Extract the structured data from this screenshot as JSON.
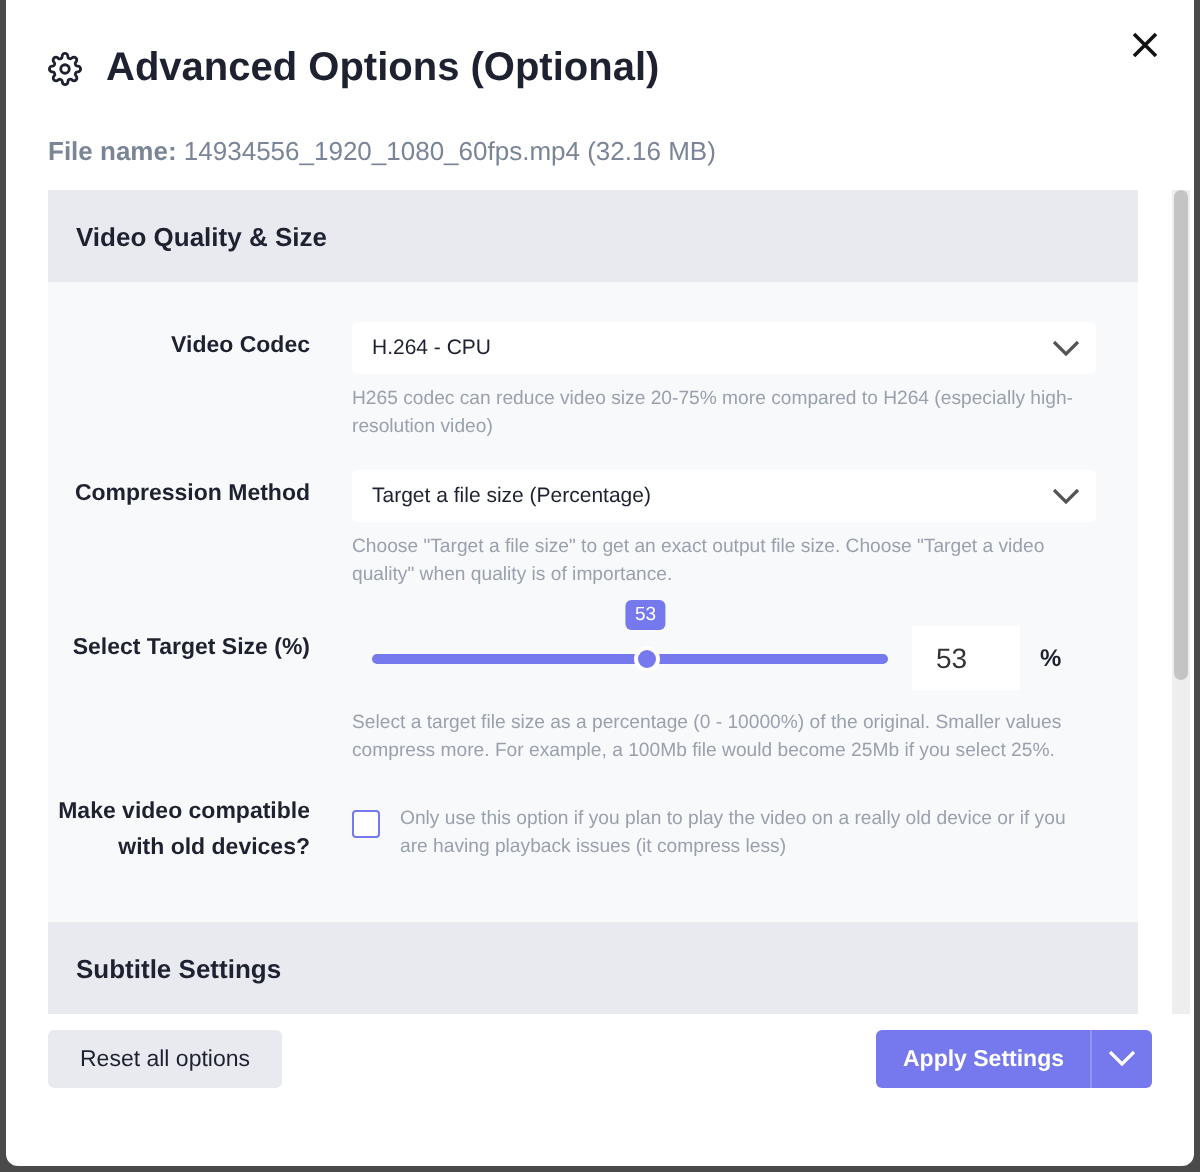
{
  "dialog": {
    "title": "Advanced Options (Optional)",
    "file_label": "File name:",
    "file_value": "14934556_1920_1080_60fps.mp4 (32.16 MB)"
  },
  "sections": [
    {
      "title": "Video Quality & Size",
      "fields": [
        {
          "kind": "select",
          "label": "Video Codec",
          "value": "H.264 - CPU",
          "help": "H265 codec can reduce video size 20-75% more compared to H264 (especially high-resolution video)"
        },
        {
          "kind": "select",
          "label": "Compression Method",
          "value": "Target a file size (Percentage)",
          "help": "Choose \"Target a file size\" to get an exact output file size. Choose \"Target a video quality\" when quality is of importance."
        },
        {
          "kind": "slider",
          "label": "Select Target Size (%)",
          "level": 0.53,
          "bubble": "53",
          "value": "53",
          "unit": "%",
          "help": "Select a target file size as a percentage (0 - 10000%) of the original. Smaller values compress more. For example, a 100Mb file would become 25Mb if you select 25%."
        },
        {
          "kind": "checkbox",
          "label": "Make video compatible with old devices?",
          "checked": false,
          "help": "Only use this option if you plan to play the video on a really old device or if you are having playback issues (it compress less)"
        }
      ]
    },
    {
      "title": "Subtitle Settings"
    }
  ],
  "footer": {
    "reset": "Reset all options",
    "apply": "Apply Settings"
  }
}
